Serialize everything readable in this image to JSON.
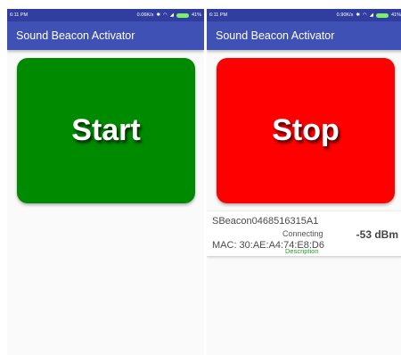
{
  "left_screen": {
    "status_bar": {
      "time": "6:11 PM",
      "network": "0.06K/s",
      "battery": "41%"
    },
    "title": "Sound Beacon Activator",
    "action_button": {
      "label": "Start",
      "color": "#008a00"
    }
  },
  "right_screen": {
    "status_bar": {
      "time": "6:11 PM",
      "network": "0.90K/s",
      "battery": "41%"
    },
    "title": "Sound Beacon Activator",
    "action_button": {
      "label": "Stop",
      "color": "#ff0000"
    },
    "beacon": {
      "name": "SBeacon0468516315A1",
      "status": "Connecting",
      "mac": "MAC: 30:AE:A4:74:E8:D6",
      "description": "Description",
      "rssi": "-53 dBm"
    }
  },
  "colors": {
    "status_bar": "#303f9f",
    "app_bar": "#3f51b5"
  },
  "icons": [
    "bluetooth-icon",
    "wifi-icon",
    "signal-icon",
    "battery-icon"
  ]
}
